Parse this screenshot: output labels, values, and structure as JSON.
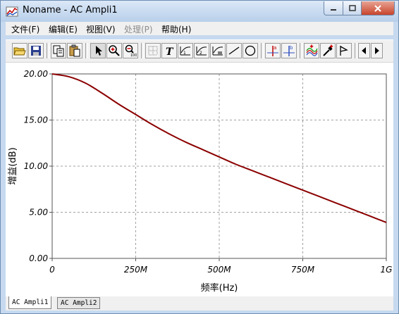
{
  "window": {
    "title": "Noname - AC Ampli1"
  },
  "menu": [
    "文件(F)",
    "编辑(E)",
    "视图(V)",
    "处理(P)",
    "帮助(H)"
  ],
  "menu_disabled_index": 3,
  "toolbar": {
    "buttons": [
      {
        "name": "open-icon"
      },
      {
        "name": "save-icon"
      },
      {
        "name": "copy-icon"
      },
      {
        "name": "paste-icon"
      },
      {
        "name": "select-pointer-icon"
      },
      {
        "name": "zoom-in-icon"
      },
      {
        "name": "zoom-100-icon"
      },
      {
        "name": "grid-icon"
      },
      {
        "name": "text-icon",
        "label": "T"
      },
      {
        "name": "axis-label-1-icon"
      },
      {
        "name": "axis-label-2-icon"
      },
      {
        "name": "axis-label-3-icon"
      },
      {
        "name": "line-icon"
      },
      {
        "name": "ellipse-icon"
      },
      {
        "name": "cursor-a-icon",
        "label": "a"
      },
      {
        "name": "cursor-b-icon",
        "label": "b"
      },
      {
        "name": "add-trace-icon"
      },
      {
        "name": "eyedropper-icon"
      },
      {
        "name": "flag-icon"
      },
      {
        "name": "scroll-left-icon"
      },
      {
        "name": "scroll-right-icon"
      }
    ]
  },
  "chart_data": {
    "type": "line",
    "xlabel": "频率(Hz)",
    "ylabel": "增益(dB)",
    "xlim": [
      0,
      1000000000
    ],
    "ylim": [
      0,
      20
    ],
    "x_ticks": [
      0,
      250000000,
      500000000,
      750000000,
      1000000000
    ],
    "x_tick_labels": [
      "0",
      "250M",
      "500M",
      "750M",
      "1G"
    ],
    "y_ticks": [
      0,
      5,
      10,
      15,
      20
    ],
    "y_tick_labels": [
      "0.00",
      "5.00",
      "10.00",
      "15.00",
      "20.00"
    ],
    "grid": true,
    "series": [
      {
        "color": "#8b0000",
        "x": [
          0,
          50000000,
          100000000,
          150000000,
          200000000,
          250000000,
          300000000,
          350000000,
          400000000,
          450000000,
          500000000,
          550000000,
          600000000,
          650000000,
          700000000,
          750000000,
          800000000,
          850000000,
          900000000,
          950000000,
          1000000000
        ],
        "y": [
          20.0,
          19.7,
          19.0,
          17.9,
          16.7,
          15.6,
          14.5,
          13.5,
          12.6,
          11.8,
          11.0,
          10.2,
          9.5,
          8.8,
          8.1,
          7.4,
          6.7,
          6.0,
          5.3,
          4.6,
          3.9
        ]
      }
    ]
  },
  "tabs": [
    {
      "label": "AC Ampli1",
      "active": true
    },
    {
      "label": "AC Ampli2",
      "active": false
    }
  ],
  "colors": {
    "title_bar": "#c6d9ef",
    "trace": "#8b0000",
    "grid": "#a0a0a0",
    "close_button": "#c8442c"
  }
}
